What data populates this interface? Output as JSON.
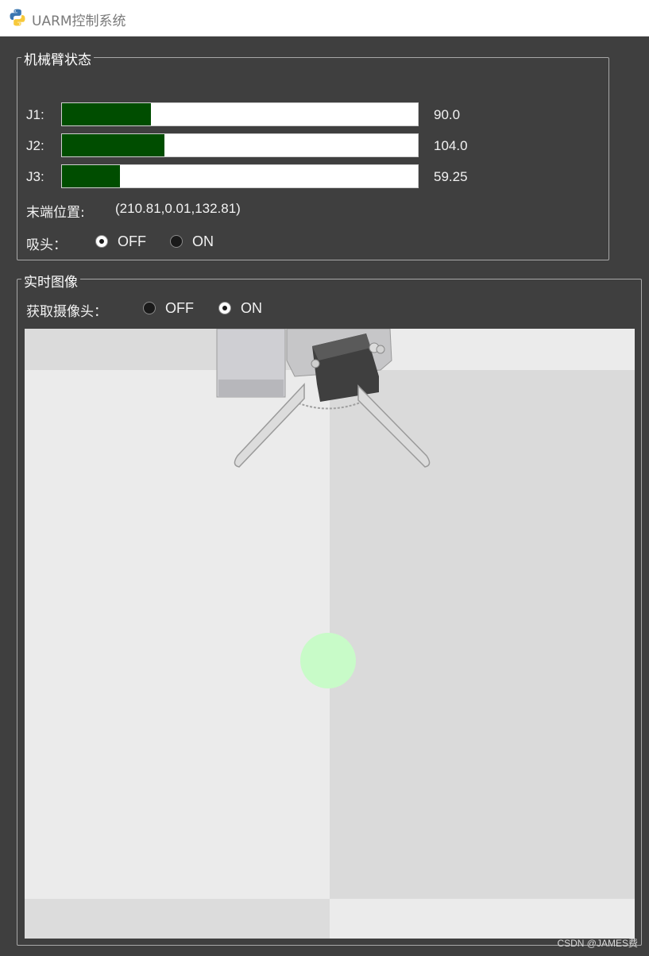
{
  "window": {
    "title": "UARM控制系统",
    "icon": "python-icon"
  },
  "arm_status": {
    "group_title": "机械臂状态",
    "joints": [
      {
        "label": "J1:",
        "value": "90.0",
        "fill_fraction": 0.25
      },
      {
        "label": "J2:",
        "value": "104.0",
        "fill_fraction": 0.287
      },
      {
        "label": "J3:",
        "value": "59.25",
        "fill_fraction": 0.162
      }
    ],
    "end_position_label": "末端位置:",
    "end_position_value": "(210.81,0.01,132.81)",
    "suction": {
      "label": "吸头：",
      "options": [
        "OFF",
        "ON"
      ],
      "selected": "OFF"
    }
  },
  "live_image": {
    "group_title": "实时图像",
    "camera": {
      "label": "获取摄像头：",
      "options": [
        "OFF",
        "ON"
      ],
      "selected": "ON"
    }
  },
  "colors": {
    "bar_fill": "#004d00",
    "background": "#3f3f3f",
    "target_dot": "#c8fbc8"
  },
  "watermark": "CSDN @JAMES费"
}
